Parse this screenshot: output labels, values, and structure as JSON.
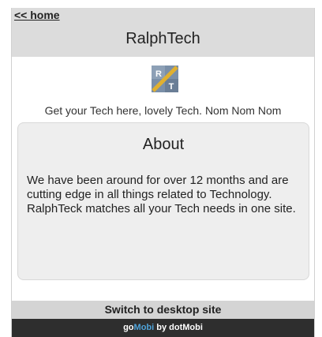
{
  "header": {
    "home_link": "<< home",
    "site_title": "RalphTech"
  },
  "logo": {
    "letter_top": "R",
    "letter_bottom": "T",
    "colors": {
      "background": "#7a8fa8",
      "stripe": "#e0b030",
      "letters": "#ffffff"
    }
  },
  "tagline": "Get your Tech here, lovely Tech. Nom Nom Nom",
  "about": {
    "title": "About",
    "text": "We have been around for over 12 months and are cutting edge in all things related to Technology. RalphTeck matches all your Tech needs in one site."
  },
  "switch_label": "Switch to desktop site",
  "footer": {
    "go": "go",
    "mobi": "Mobi",
    "by": " by dotMobi"
  }
}
